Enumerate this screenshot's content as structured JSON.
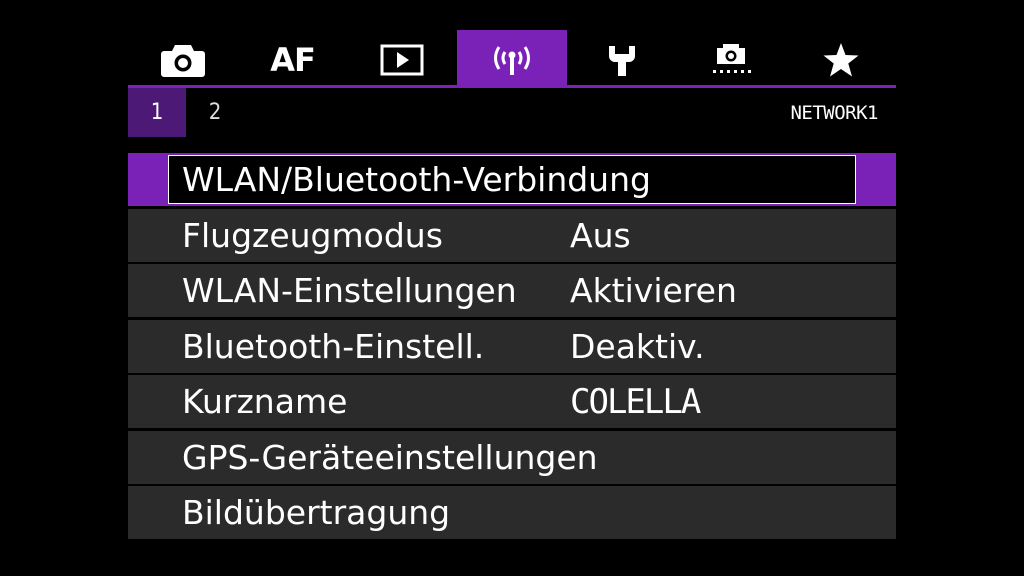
{
  "tabs": [
    {
      "icon": "camera-icon"
    },
    {
      "label": "AF"
    },
    {
      "icon": "playback-icon"
    },
    {
      "icon": "wireless-icon",
      "active": true
    },
    {
      "icon": "wrench-icon"
    },
    {
      "icon": "custom-function-icon"
    },
    {
      "icon": "star-icon"
    }
  ],
  "subtabs": [
    "1",
    "2"
  ],
  "page_name": "NETWORK1",
  "items": [
    {
      "label": "WLAN/Bluetooth-Verbindung",
      "value": ""
    },
    {
      "label": "Flugzeugmodus",
      "value": "Aus"
    },
    {
      "label": "WLAN-Einstellungen",
      "value": "Aktivieren"
    },
    {
      "label": "Bluetooth-Einstell.",
      "value": "Deaktiv."
    },
    {
      "label": "Kurzname",
      "value": "COLELLA"
    },
    {
      "label": "GPS-Geräteeinstellungen",
      "value": ""
    },
    {
      "label": "Bildübertragung",
      "value": ""
    }
  ],
  "colors": {
    "accent": "#7a22b8",
    "row": "#2b2b2b",
    "subtab_active": "#4c1a76"
  }
}
